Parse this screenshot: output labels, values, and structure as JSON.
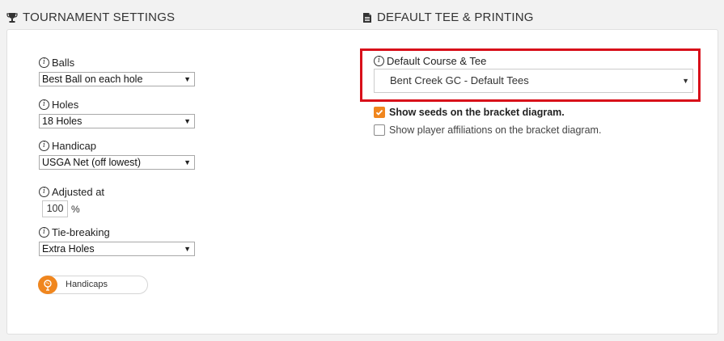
{
  "tournament": {
    "title": "TOURNAMENT SETTINGS",
    "balls_label": "Balls",
    "balls_value": "Best Ball on each hole",
    "holes_label": "Holes",
    "holes_value": "18 Holes",
    "handicap_label": "Handicap",
    "handicap_value": "USGA Net (off lowest)",
    "adjusted_label": "Adjusted at",
    "adjusted_value": "100",
    "adjusted_unit": "%",
    "tiebreak_label": "Tie-breaking",
    "tiebreak_value": "Extra Holes",
    "handicaps_toggle_label": "Handicaps"
  },
  "printing": {
    "title": "DEFAULT TEE & PRINTING",
    "course_tee_label": "Default Course & Tee",
    "course_tee_value": "Bent Creek GC - Default Tees",
    "show_seeds_label": "Show seeds on the bracket diagram.",
    "show_seeds_checked": true,
    "show_affiliations_label": "Show player affiliations on the bracket diagram.",
    "show_affiliations_checked": false
  },
  "icons": {
    "tournament": "trophy-icon",
    "printing": "document-icon",
    "info": "info-icon",
    "handicaps": "golf-ball-icon"
  },
  "colors": {
    "accent": "#f0861e",
    "highlight": "#d8101a"
  }
}
